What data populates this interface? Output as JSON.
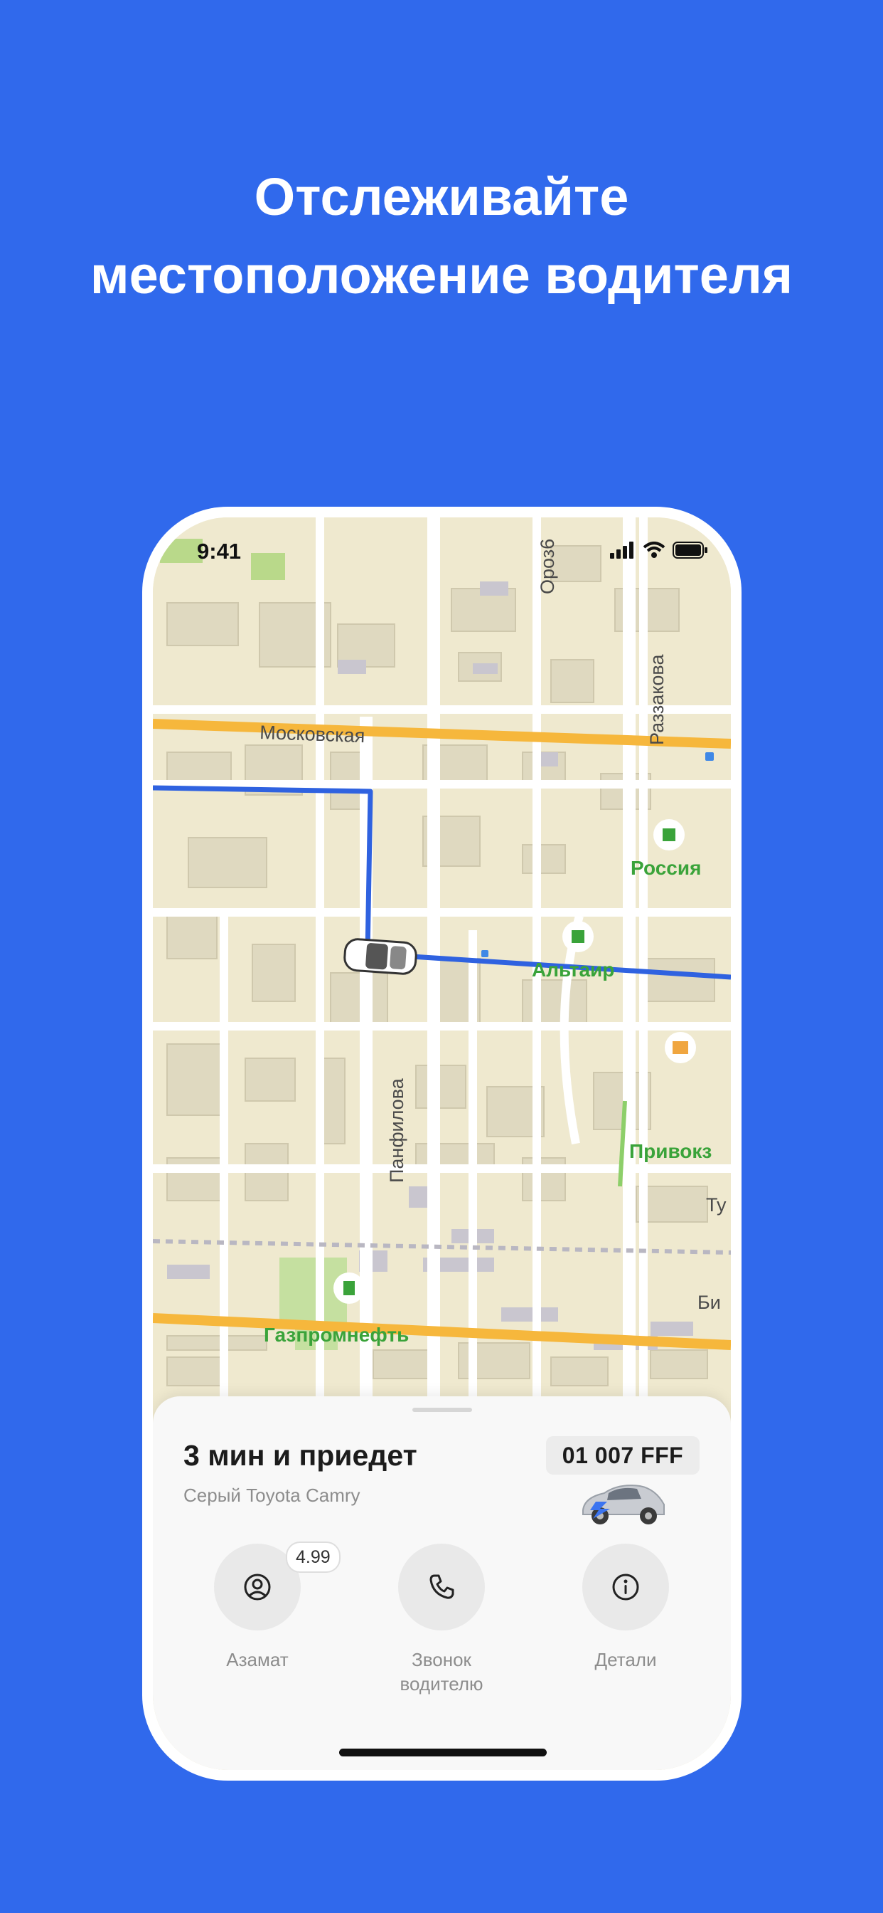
{
  "headline": {
    "line1": "Отслеживайте",
    "line2": "местоположение водителя"
  },
  "status_bar": {
    "time": "9:41"
  },
  "map": {
    "streets": [
      "Московская",
      "Раззакова",
      "Ороз6",
      "Панфилова",
      "Ту",
      "Би"
    ],
    "places": [
      "Россия",
      "Альтаир",
      "Привокз",
      "Газпромнефть"
    ]
  },
  "ride": {
    "eta": "3 мин и приедет",
    "car_description": "Серый Toyota Camry",
    "plate": "01 007 FFF"
  },
  "actions": {
    "driver": {
      "label": "Азамат",
      "rating": "4.99"
    },
    "call": {
      "label_line1": "Звонок",
      "label_line2": "водителю"
    },
    "details": {
      "label": "Детали"
    }
  },
  "colors": {
    "background": "#3069ec",
    "route": "#2f62e0",
    "main_road": "#f6b73c",
    "poi_green": "#3aa33a"
  }
}
